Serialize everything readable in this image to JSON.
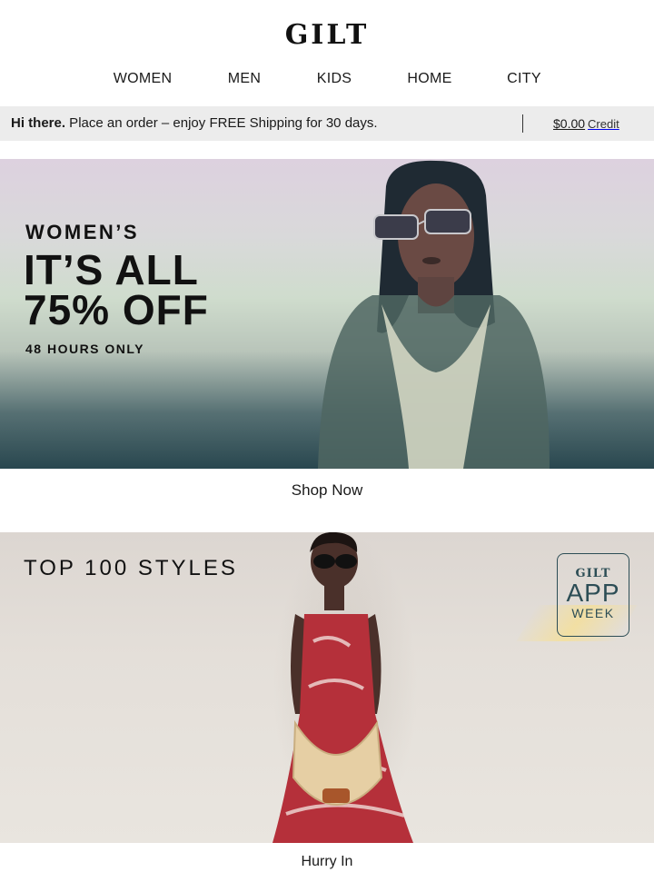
{
  "brand": {
    "name": "GILT"
  },
  "nav": {
    "items": [
      {
        "label": "WOMEN"
      },
      {
        "label": "MEN"
      },
      {
        "label": "KIDS"
      },
      {
        "label": "HOME"
      },
      {
        "label": "CITY"
      }
    ]
  },
  "promo": {
    "greeting": "Hi there.",
    "message": " Place an order – enjoy FREE Shipping for 30 days.",
    "credit_amount": "$0.00",
    "credit_label": "Credit"
  },
  "hero1": {
    "subtitle": "WOMEN’S",
    "headline": "IT’S ALL\n75% OFF",
    "note": "48 HOURS ONLY",
    "cta": "Shop Now"
  },
  "hero2": {
    "title": "TOP 100 STYLES",
    "badge": {
      "brand": "GILT",
      "line1": "APP",
      "line2": "WEEK"
    },
    "cta": "Hurry In"
  },
  "colors": {
    "promo_bg": "#ececec",
    "badge": "#2c4d55",
    "hero1_top": "#ddd1df",
    "hero1_bottom": "#29474f"
  }
}
